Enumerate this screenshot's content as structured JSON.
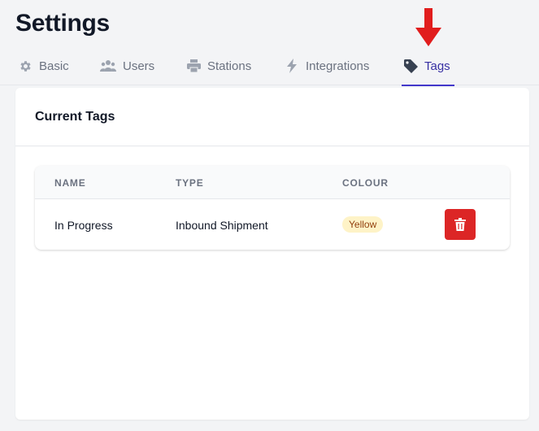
{
  "page": {
    "title": "Settings"
  },
  "tabs": [
    {
      "id": "basic",
      "label": "Basic",
      "icon": "gear-icon",
      "active": false
    },
    {
      "id": "users",
      "label": "Users",
      "icon": "users-icon",
      "active": false
    },
    {
      "id": "stations",
      "label": "Stations",
      "icon": "printer-icon",
      "active": false
    },
    {
      "id": "integrations",
      "label": "Integrations",
      "icon": "lightning-icon",
      "active": false
    },
    {
      "id": "tags",
      "label": "Tags",
      "icon": "tag-icon",
      "active": true
    }
  ],
  "card": {
    "title": "Current Tags",
    "table": {
      "columns": [
        "NAME",
        "TYPE",
        "COLOUR"
      ],
      "rows": [
        {
          "name": "In Progress",
          "type": "Inbound Shipment",
          "colour": "Yellow",
          "action_icon": "trash-icon"
        }
      ]
    }
  },
  "colors": {
    "accent": "#4338ca",
    "danger": "#dc2626",
    "badge_bg": "#fef3c7",
    "badge_text": "#92400e",
    "annotation_arrow": "#e11d1d"
  }
}
